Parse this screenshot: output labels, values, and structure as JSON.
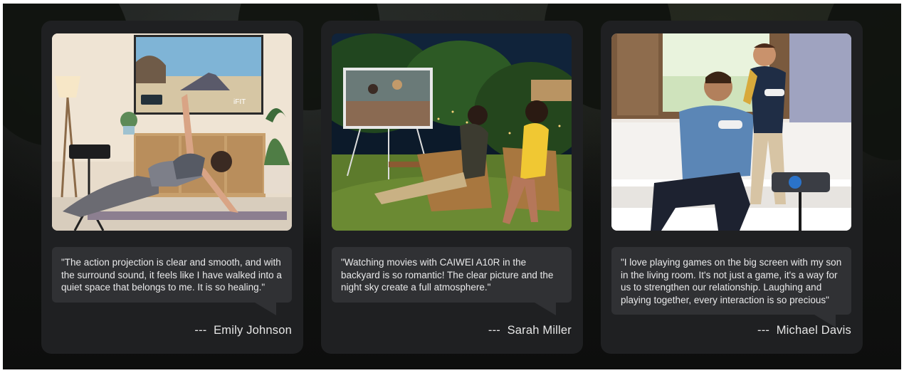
{
  "testimonials": [
    {
      "image_alt": "Woman doing yoga in front of projected workout video",
      "quote": "\"The action projection is clear and smooth, and with the surround sound, it feels like I have walked into a quiet space that belongs to me. It is so healing.\"",
      "dash": "---",
      "author": "Emily Johnson",
      "screen_text": "iFIT"
    },
    {
      "image_alt": "Two women watching a movie in the backyard at night",
      "quote": "\"Watching movies with CAIWEI A10R in the backyard is so romantic! The clear picture and the night sky create a full atmosphere.\"",
      "dash": "---",
      "author": "Sarah Miller"
    },
    {
      "image_alt": "Father and son playing video games on the couch",
      "quote": "\"I love playing games on the big screen with my son in the living room. It's not just a game, it's a way for us to strengthen our relationship. Laughing and playing together, every interaction is so precious\"",
      "dash": "---",
      "author": "Michael Davis"
    }
  ],
  "colors": {
    "page_bg": "#121312",
    "card_bg": "#1f2022",
    "bubble_bg": "#303134",
    "text": "#e9e9ea"
  }
}
